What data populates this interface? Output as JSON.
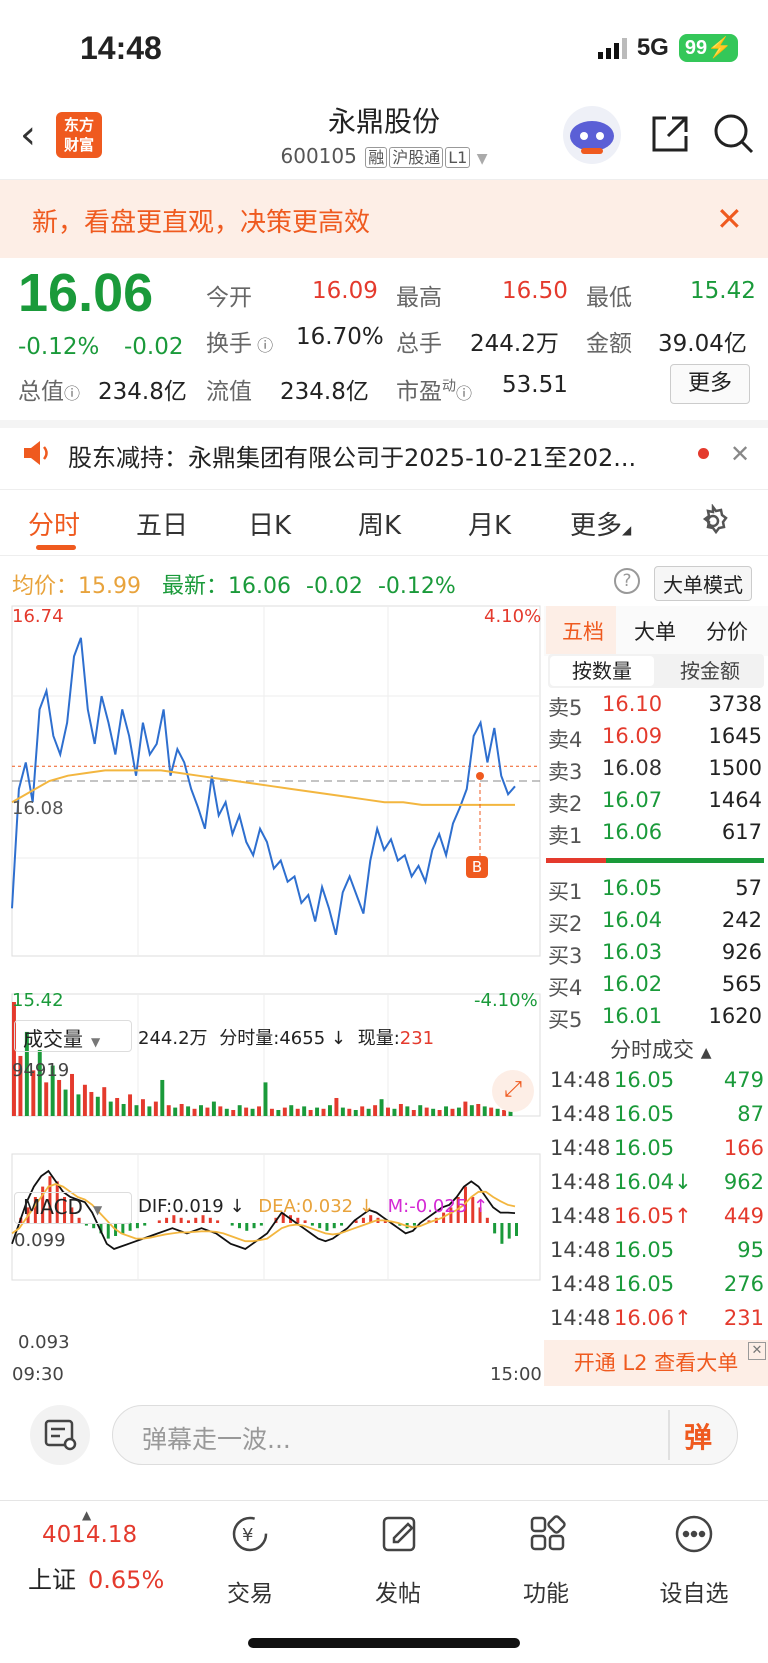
{
  "status_bar": {
    "time": "14:48",
    "network": "5G",
    "battery": "99"
  },
  "header": {
    "logo_line1": "东方",
    "logo_line2": "财富",
    "title": "永鼎股份",
    "code": "600105",
    "tags": [
      "融",
      "沪股通",
      "L1"
    ]
  },
  "banner": {
    "text": "新，看盘更直观，决策更高效"
  },
  "quote": {
    "price": "16.06",
    "change_pct": "-0.12%",
    "change": "-0.02",
    "open_label": "今开",
    "open": "16.09",
    "high_label": "最高",
    "high": "16.50",
    "low_label": "最低",
    "low": "15.42",
    "turnover_label": "换手",
    "turnover": "16.70%",
    "volume_label": "总手",
    "volume": "244.2万",
    "amount_label": "金额",
    "amount": "39.04亿",
    "mktcap_label": "总值",
    "mktcap": "234.8亿",
    "float_label": "流值",
    "float": "234.8亿",
    "pe_label": "市盈",
    "pe_sup": "动",
    "pe": "53.51",
    "more": "更多"
  },
  "notice": {
    "text": "股东减持：永鼎集团有限公司于2025-10-21至202..."
  },
  "tabs": [
    "分时",
    "五日",
    "日K",
    "周K",
    "月K",
    "更多"
  ],
  "chart_header": {
    "avg_label": "均价：",
    "avg": "15.99",
    "latest_label": "最新：",
    "latest": "16.06",
    "latest_chg": "-0.02",
    "latest_pct": "-0.12%",
    "big_mode": "大单模式"
  },
  "chart_data": [
    {
      "type": "line",
      "title": "",
      "series": [
        {
          "name": "",
          "values": [
            15.6,
            16.05,
            16.15,
            16.0,
            16.35,
            16.42,
            16.25,
            16.18,
            16.3,
            16.55,
            16.62,
            16.35,
            16.22,
            16.4,
            16.3,
            16.18,
            16.35,
            16.25,
            16.1,
            16.3,
            16.18,
            16.22,
            16.35,
            16.1,
            16.2,
            16.15,
            16.05,
            15.98,
            15.9,
            16.1,
            15.95,
            16.0,
            15.88,
            15.95,
            15.85,
            15.8,
            15.9,
            15.85,
            15.75,
            15.78,
            15.7,
            15.72,
            15.62,
            15.65,
            15.55,
            15.68,
            15.6,
            15.5,
            15.66,
            15.72,
            15.65,
            15.58,
            15.78,
            15.9,
            15.82,
            15.86,
            15.78,
            15.8,
            15.72,
            15.76,
            15.7,
            15.82,
            15.88,
            15.8,
            15.92,
            15.98,
            16.05,
            16.25,
            16.3,
            16.15,
            16.28,
            16.1,
            16.03,
            16.06
          ]
        }
      ],
      "avg_series": [
        16.0,
        16.04,
        16.08,
        16.1,
        16.11,
        16.12,
        16.12,
        16.12,
        16.12,
        16.11,
        16.1,
        16.09,
        16.08,
        16.07,
        16.06,
        16.05,
        16.04,
        16.03,
        16.02,
        16.01,
        16.0,
        16.0,
        15.99,
        15.99,
        15.99,
        15.99,
        15.99,
        15.99
      ],
      "ylim": [
        15.42,
        16.74
      ],
      "y_left_labels": [
        "16.74",
        "16.08",
        "15.42"
      ],
      "y_right_labels": [
        "4.10%",
        "-4.10%"
      ],
      "x_labels": [
        "09:30",
        "15:00"
      ],
      "prev_close": 16.08,
      "marker": "B"
    },
    {
      "type": "bar",
      "title": "",
      "max_label": "94919",
      "values": [
        94919,
        50000,
        70000,
        38000,
        55000,
        28000,
        42000,
        30000,
        22000,
        35000,
        18000,
        26000,
        20000,
        16000,
        24000,
        12000,
        15000,
        10000,
        18000,
        9000,
        14000,
        8000,
        12000,
        30000,
        9000,
        7000,
        10000,
        8000,
        6000,
        9000,
        7000,
        12000,
        8000,
        6000,
        5000,
        9000,
        7000,
        6000,
        8000,
        28000,
        6000,
        5000,
        7000,
        9000,
        6000,
        8000,
        5000,
        7000,
        6000,
        9000,
        15000,
        7000,
        6000,
        5000,
        8000,
        6000,
        9000,
        14000,
        7000,
        6000,
        10000,
        8000,
        5000,
        9000,
        7000,
        6000,
        5000,
        8000,
        6000,
        7000,
        12000,
        9000,
        10000,
        8000,
        7000,
        6000,
        5000,
        4000
      ],
      "colors": [
        "red",
        "red",
        "green",
        "red",
        "green",
        "red",
        "green",
        "red",
        "green",
        "red",
        "green",
        "red",
        "red",
        "green",
        "red",
        "green",
        "red",
        "green",
        "red",
        "green",
        "red",
        "green",
        "red",
        "green",
        "red",
        "green",
        "red",
        "green",
        "red",
        "green",
        "red",
        "green",
        "red",
        "green",
        "red",
        "green",
        "red",
        "green",
        "red",
        "green",
        "red",
        "green",
        "red",
        "green",
        "red",
        "green",
        "red",
        "green",
        "red",
        "green",
        "red",
        "green",
        "red",
        "green",
        "red",
        "green",
        "red",
        "green",
        "red",
        "green",
        "red",
        "green",
        "red",
        "green",
        "red",
        "green",
        "red",
        "green",
        "red",
        "green",
        "red",
        "green",
        "red",
        "green",
        "red",
        "green",
        "red",
        "green"
      ]
    },
    {
      "type": "line",
      "title": "",
      "y_labels": [
        "0.099",
        "0.093"
      ],
      "macd": [
        0,
        0.01,
        0.03,
        0.05,
        0.07,
        0.09,
        0.08,
        0.05,
        0.03,
        0.01,
        -0.005,
        -0.01,
        -0.02,
        -0.03,
        -0.025,
        -0.02,
        -0.015,
        -0.01,
        -0.005,
        0,
        0.005,
        0.01,
        0.015,
        0.01,
        0.005,
        0.01,
        0.015,
        0.01,
        0.005,
        0,
        -0.005,
        -0.01,
        -0.015,
        -0.01,
        -0.005,
        0,
        0.01,
        0.02,
        0.015,
        0.01,
        0.005,
        -0.005,
        -0.01,
        -0.015,
        -0.01,
        -0.005,
        0,
        0.005,
        0.01,
        0.015,
        0.01,
        0.005,
        0,
        -0.005,
        -0.01,
        -0.005,
        0,
        0.005,
        0.01,
        0.02,
        0.03,
        0.05,
        0.07,
        0.05,
        0.03,
        0.01,
        -0.02,
        -0.04,
        -0.03,
        -0.025
      ],
      "dif": [
        -0.04,
        0,
        0.04,
        0.07,
        0.09,
        0.1,
        0.08,
        0.06,
        0.05,
        0.045,
        0.04,
        0.02,
        -0.01,
        -0.04,
        -0.05,
        -0.045,
        -0.04,
        -0.035,
        -0.03,
        -0.025,
        -0.02,
        -0.015,
        -0.01,
        -0.015,
        -0.02,
        -0.015,
        -0.01,
        -0.015,
        -0.02,
        -0.03,
        -0.04,
        -0.045,
        -0.05,
        -0.04,
        -0.03,
        -0.02,
        0,
        0.02,
        0.01,
        0,
        -0.01,
        -0.02,
        -0.03,
        -0.035,
        -0.03,
        -0.02,
        -0.01,
        0.005,
        0.015,
        0.025,
        0.02,
        0.01,
        0,
        -0.01,
        -0.02,
        -0.015,
        0,
        0.01,
        0.02,
        0.03,
        0.035,
        0.05,
        0.07,
        0.08,
        0.07,
        0.05,
        0.03,
        0.02,
        0.02,
        0.019
      ],
      "dea": [
        -0.02,
        -0.01,
        0.01,
        0.03,
        0.05,
        0.07,
        0.075,
        0.07,
        0.06,
        0.05,
        0.045,
        0.035,
        0.02,
        0.005,
        -0.01,
        -0.02,
        -0.025,
        -0.03,
        -0.03,
        -0.028,
        -0.025,
        -0.022,
        -0.02,
        -0.018,
        -0.018,
        -0.017,
        -0.016,
        -0.016,
        -0.017,
        -0.02,
        -0.025,
        -0.03,
        -0.035,
        -0.035,
        -0.033,
        -0.03,
        -0.02,
        -0.01,
        -0.005,
        -0.003,
        -0.005,
        -0.01,
        -0.015,
        -0.02,
        -0.022,
        -0.02,
        -0.015,
        -0.01,
        -0.005,
        0,
        0.005,
        0.005,
        0.003,
        0,
        -0.005,
        -0.008,
        -0.006,
        0,
        0.005,
        0.01,
        0.018,
        0.025,
        0.035,
        0.05,
        0.06,
        0.06,
        0.05,
        0.042,
        0.035,
        0.032
      ]
    }
  ],
  "volume_header": {
    "label": "成交量",
    "total": "244.2万",
    "fs_label": "分时量:",
    "fs_value": "4655",
    "now_label": "现量:",
    "now_value": "231"
  },
  "macd_header": {
    "label": "MACD",
    "dif": "DIF:0.019",
    "dea": "DEA:0.032",
    "m": "M:-0.025"
  },
  "right_panel": {
    "tabs": [
      "五档",
      "大单",
      "分价"
    ],
    "subtabs": [
      "按数量",
      "按金额"
    ],
    "asks": [
      {
        "label": "卖5",
        "price": "16.10",
        "vol": "3738",
        "color": "red"
      },
      {
        "label": "卖4",
        "price": "16.09",
        "vol": "1645",
        "color": "red"
      },
      {
        "label": "卖3",
        "price": "16.08",
        "vol": "1500",
        "color": "gray"
      },
      {
        "label": "卖2",
        "price": "16.07",
        "vol": "1464",
        "color": "green"
      },
      {
        "label": "卖1",
        "price": "16.06",
        "vol": "617",
        "color": "green"
      }
    ],
    "bids": [
      {
        "label": "买1",
        "price": "16.05",
        "vol": "57",
        "color": "green"
      },
      {
        "label": "买2",
        "price": "16.04",
        "vol": "242",
        "color": "green"
      },
      {
        "label": "买3",
        "price": "16.03",
        "vol": "926",
        "color": "green"
      },
      {
        "label": "买4",
        "price": "16.02",
        "vol": "565",
        "color": "green"
      },
      {
        "label": "买5",
        "price": "16.01",
        "vol": "1620",
        "color": "green"
      }
    ],
    "ticks_title": "分时成交",
    "ticks": [
      {
        "time": "14:48",
        "price": "16.05",
        "vol": "479",
        "pc": "green",
        "vc": "green"
      },
      {
        "time": "14:48",
        "price": "16.05",
        "vol": "87",
        "pc": "green",
        "vc": "green"
      },
      {
        "time": "14:48",
        "price": "16.05",
        "vol": "166",
        "pc": "green",
        "vc": "red"
      },
      {
        "time": "14:48",
        "price": "16.04↓",
        "vol": "962",
        "pc": "green",
        "vc": "green"
      },
      {
        "time": "14:48",
        "price": "16.05↑",
        "vol": "449",
        "pc": "red",
        "vc": "red"
      },
      {
        "time": "14:48",
        "price": "16.05",
        "vol": "95",
        "pc": "green",
        "vc": "green"
      },
      {
        "time": "14:48",
        "price": "16.05",
        "vol": "276",
        "pc": "green",
        "vc": "green"
      },
      {
        "time": "14:48",
        "price": "16.06↑",
        "vol": "231",
        "pc": "red",
        "vc": "red"
      }
    ],
    "l2": "开通 L2 查看大单"
  },
  "danmu": {
    "placeholder": "弹幕走一波...",
    "button": "弹"
  },
  "bottom_nav": {
    "index_value": "4014.18",
    "index_name": "上证",
    "index_pct": "0.65%",
    "items": [
      "交易",
      "发帖",
      "功能",
      "设自选"
    ]
  }
}
